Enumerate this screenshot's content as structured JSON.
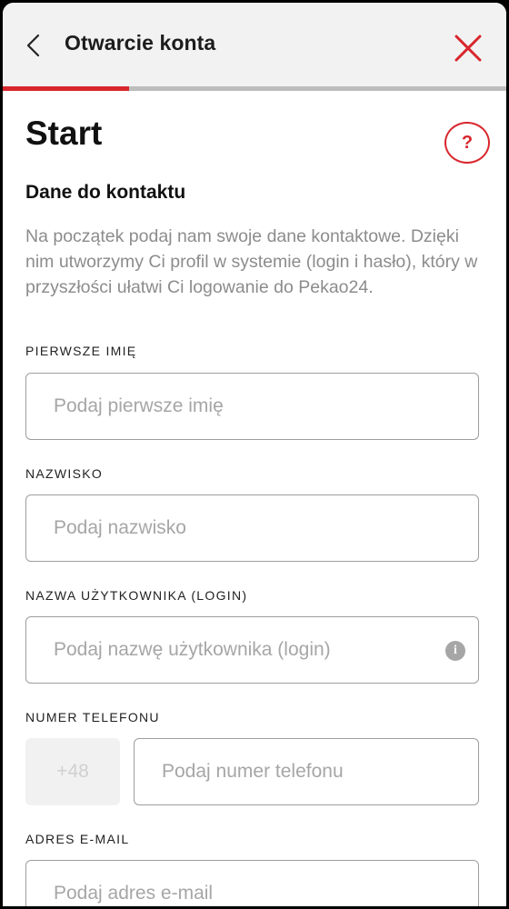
{
  "header": {
    "title": "Otwarcie konta",
    "back_icon": "chevron-left-icon",
    "close_icon": "close-icon",
    "accent_color": "#d8262d"
  },
  "progress": {
    "fraction": 0.25
  },
  "page": {
    "title": "Start",
    "help_label": "?",
    "section_title": "Dane do kontaktu",
    "intro": "Na początek podaj nam swoje dane kontaktowe. Dzięki nim utworzymy Ci profil w systemie (login i hasło), który w przyszłości ułatwi Ci logowanie do Pekao24."
  },
  "form": {
    "first_name": {
      "label": "PIERWSZE IMIĘ",
      "placeholder": "Podaj pierwsze imię",
      "value": ""
    },
    "last_name": {
      "label": "NAZWISKO",
      "placeholder": "Podaj nazwisko",
      "value": ""
    },
    "username": {
      "label": "NAZWA UŻYTKOWNIKA (LOGIN)",
      "placeholder": "Podaj nazwę użytkownika (login)",
      "value": "",
      "info_label": "i"
    },
    "phone": {
      "label": "NUMER TELEFONU",
      "prefix": "+48",
      "placeholder": "Podaj numer telefonu",
      "value": ""
    },
    "email": {
      "label": "ADRES E-MAIL",
      "placeholder": "Podaj adres e-mail",
      "value": ""
    }
  }
}
